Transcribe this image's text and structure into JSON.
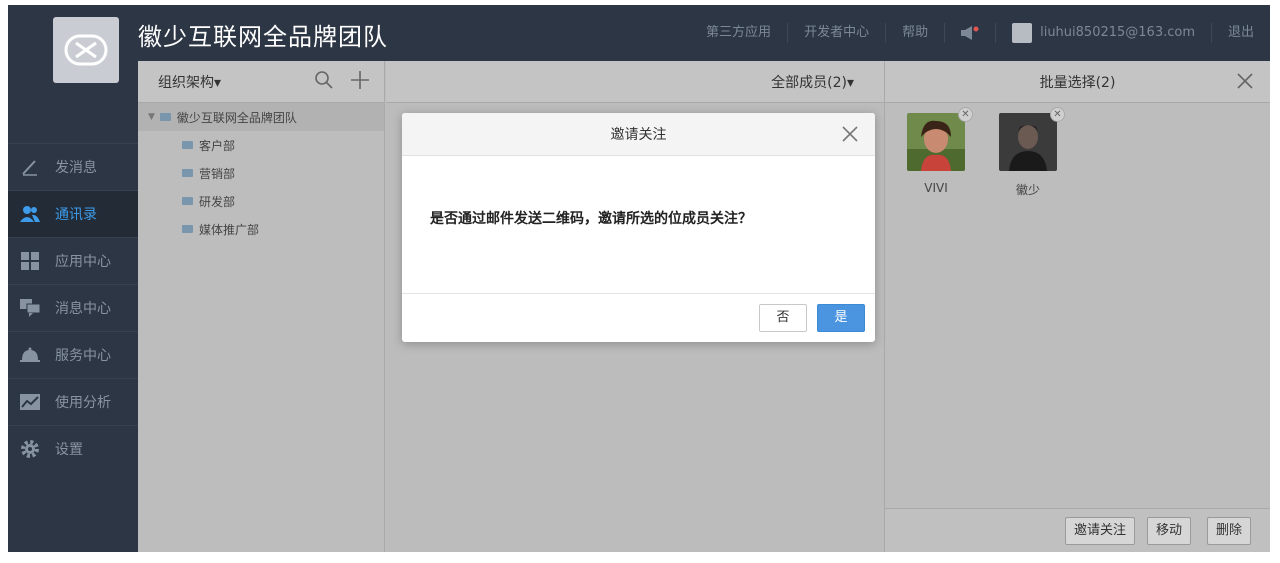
{
  "header": {
    "brand": "徽少互联网全品牌团队",
    "nav": [
      "第三方应用",
      "开发者中心",
      "帮助"
    ],
    "user_email": "liuhui850215@163.com",
    "logout": "退出"
  },
  "sidebar": {
    "items": [
      {
        "label": "发消息",
        "icon": "pencil-icon"
      },
      {
        "label": "通讯录",
        "icon": "contacts-icon"
      },
      {
        "label": "应用中心",
        "icon": "apps-icon"
      },
      {
        "label": "消息中心",
        "icon": "messages-icon"
      },
      {
        "label": "服务中心",
        "icon": "service-bell-icon"
      },
      {
        "label": "使用分析",
        "icon": "analytics-icon"
      },
      {
        "label": "设置",
        "icon": "gear-icon"
      }
    ]
  },
  "tree": {
    "title": "组织架构▾",
    "root": "徽少互联网全品牌团队",
    "departments": [
      "客户部",
      "营销部",
      "研发部",
      "媒体推广部"
    ]
  },
  "list": {
    "title": "全部成员(2)▾"
  },
  "batch": {
    "title": "批量选择(2)",
    "members": [
      {
        "name": "VIVI"
      },
      {
        "name": "徽少"
      }
    ],
    "actions": [
      "邀请关注",
      "移动",
      "删除"
    ]
  },
  "modal": {
    "title": "邀请关注",
    "message": "是否通过邮件发送二维码，邀请所选的位成员关注？",
    "no_label": "否",
    "yes_label": "是"
  },
  "colors": {
    "accent": "#4a94e0",
    "sidebar_active": "#3d9be9",
    "topbar": "#2c3644"
  }
}
